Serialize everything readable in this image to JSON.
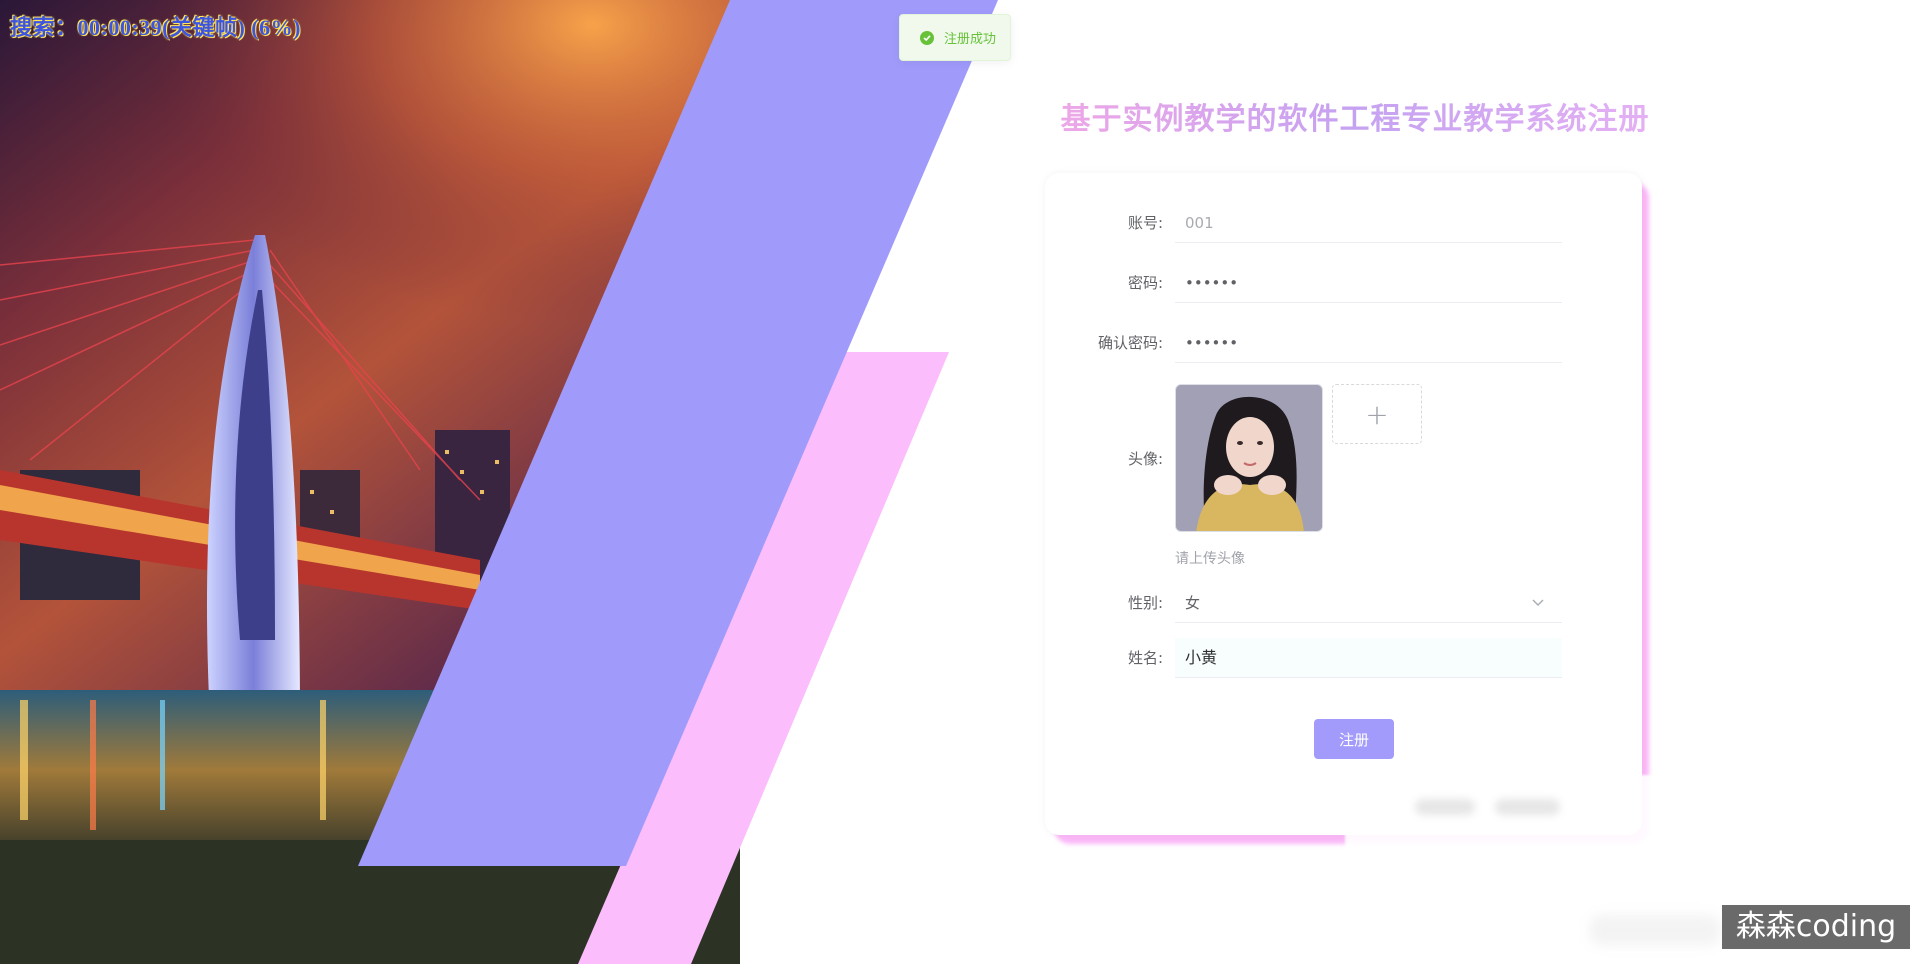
{
  "overlay": {
    "search_text": "搜索：00:00:39(关键帧) (6%)"
  },
  "toast": {
    "message": "注册成功",
    "type": "success"
  },
  "title": "基于实例教学的软件工程专业教学系统注册",
  "form": {
    "account": {
      "label": "账号:",
      "value": "001"
    },
    "password": {
      "label": "密码:",
      "value": "••••••"
    },
    "confirm_password": {
      "label": "确认密码:",
      "value": "••••••"
    },
    "avatar": {
      "label": "头像:",
      "upload_icon": "+",
      "hint": "请上传头像"
    },
    "gender": {
      "label": "性别:",
      "selected": "女"
    },
    "name": {
      "label": "姓名:",
      "value": "小黄"
    },
    "register_button": "注册"
  },
  "watermark": "森森coding",
  "colors": {
    "accent": "#a29bfb",
    "stripe_purple": "#a09bfb",
    "stripe_pink": "#fcbdfd",
    "success": "#67c23a"
  }
}
